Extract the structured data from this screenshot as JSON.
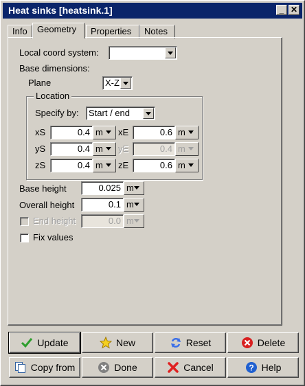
{
  "window": {
    "title": "Heat sinks [heatsink.1]"
  },
  "tabs": [
    {
      "label": "Info"
    },
    {
      "label": "Geometry"
    },
    {
      "label": "Properties"
    },
    {
      "label": "Notes"
    }
  ],
  "geometry": {
    "local_coord_label": "Local coord system:",
    "local_coord_value": "",
    "base_dims_label": "Base dimensions:",
    "plane_label": "Plane",
    "plane_value": "X-Z",
    "location_label": "Location",
    "specify_label": "Specify by:",
    "specify_value": "Start / end",
    "xs_label": "xS",
    "xs_value": "0.4",
    "xs_unit": "m",
    "xe_label": "xE",
    "xe_value": "0.6",
    "xe_unit": "m",
    "ys_label": "yS",
    "ys_value": "0.4",
    "ys_unit": "m",
    "ye_label": "yE",
    "ye_value": "0.4",
    "ye_unit": "m",
    "zs_label": "zS",
    "zs_value": "0.4",
    "zs_unit": "m",
    "ze_label": "zE",
    "ze_value": "0.6",
    "ze_unit": "m",
    "base_height_label": "Base height",
    "base_height_value": "0.025",
    "base_height_unit": "m",
    "overall_height_label": "Overall height",
    "overall_height_value": "0.1",
    "overall_height_unit": "m",
    "end_height_label": "End height",
    "end_height_value": "0.0",
    "end_height_unit": "m",
    "fix_values_label": "Fix values"
  },
  "buttons": {
    "update": "Update",
    "new": "New",
    "reset": "Reset",
    "delete": "Delete",
    "copy_from": "Copy from",
    "done": "Done",
    "cancel": "Cancel",
    "help": "Help"
  }
}
